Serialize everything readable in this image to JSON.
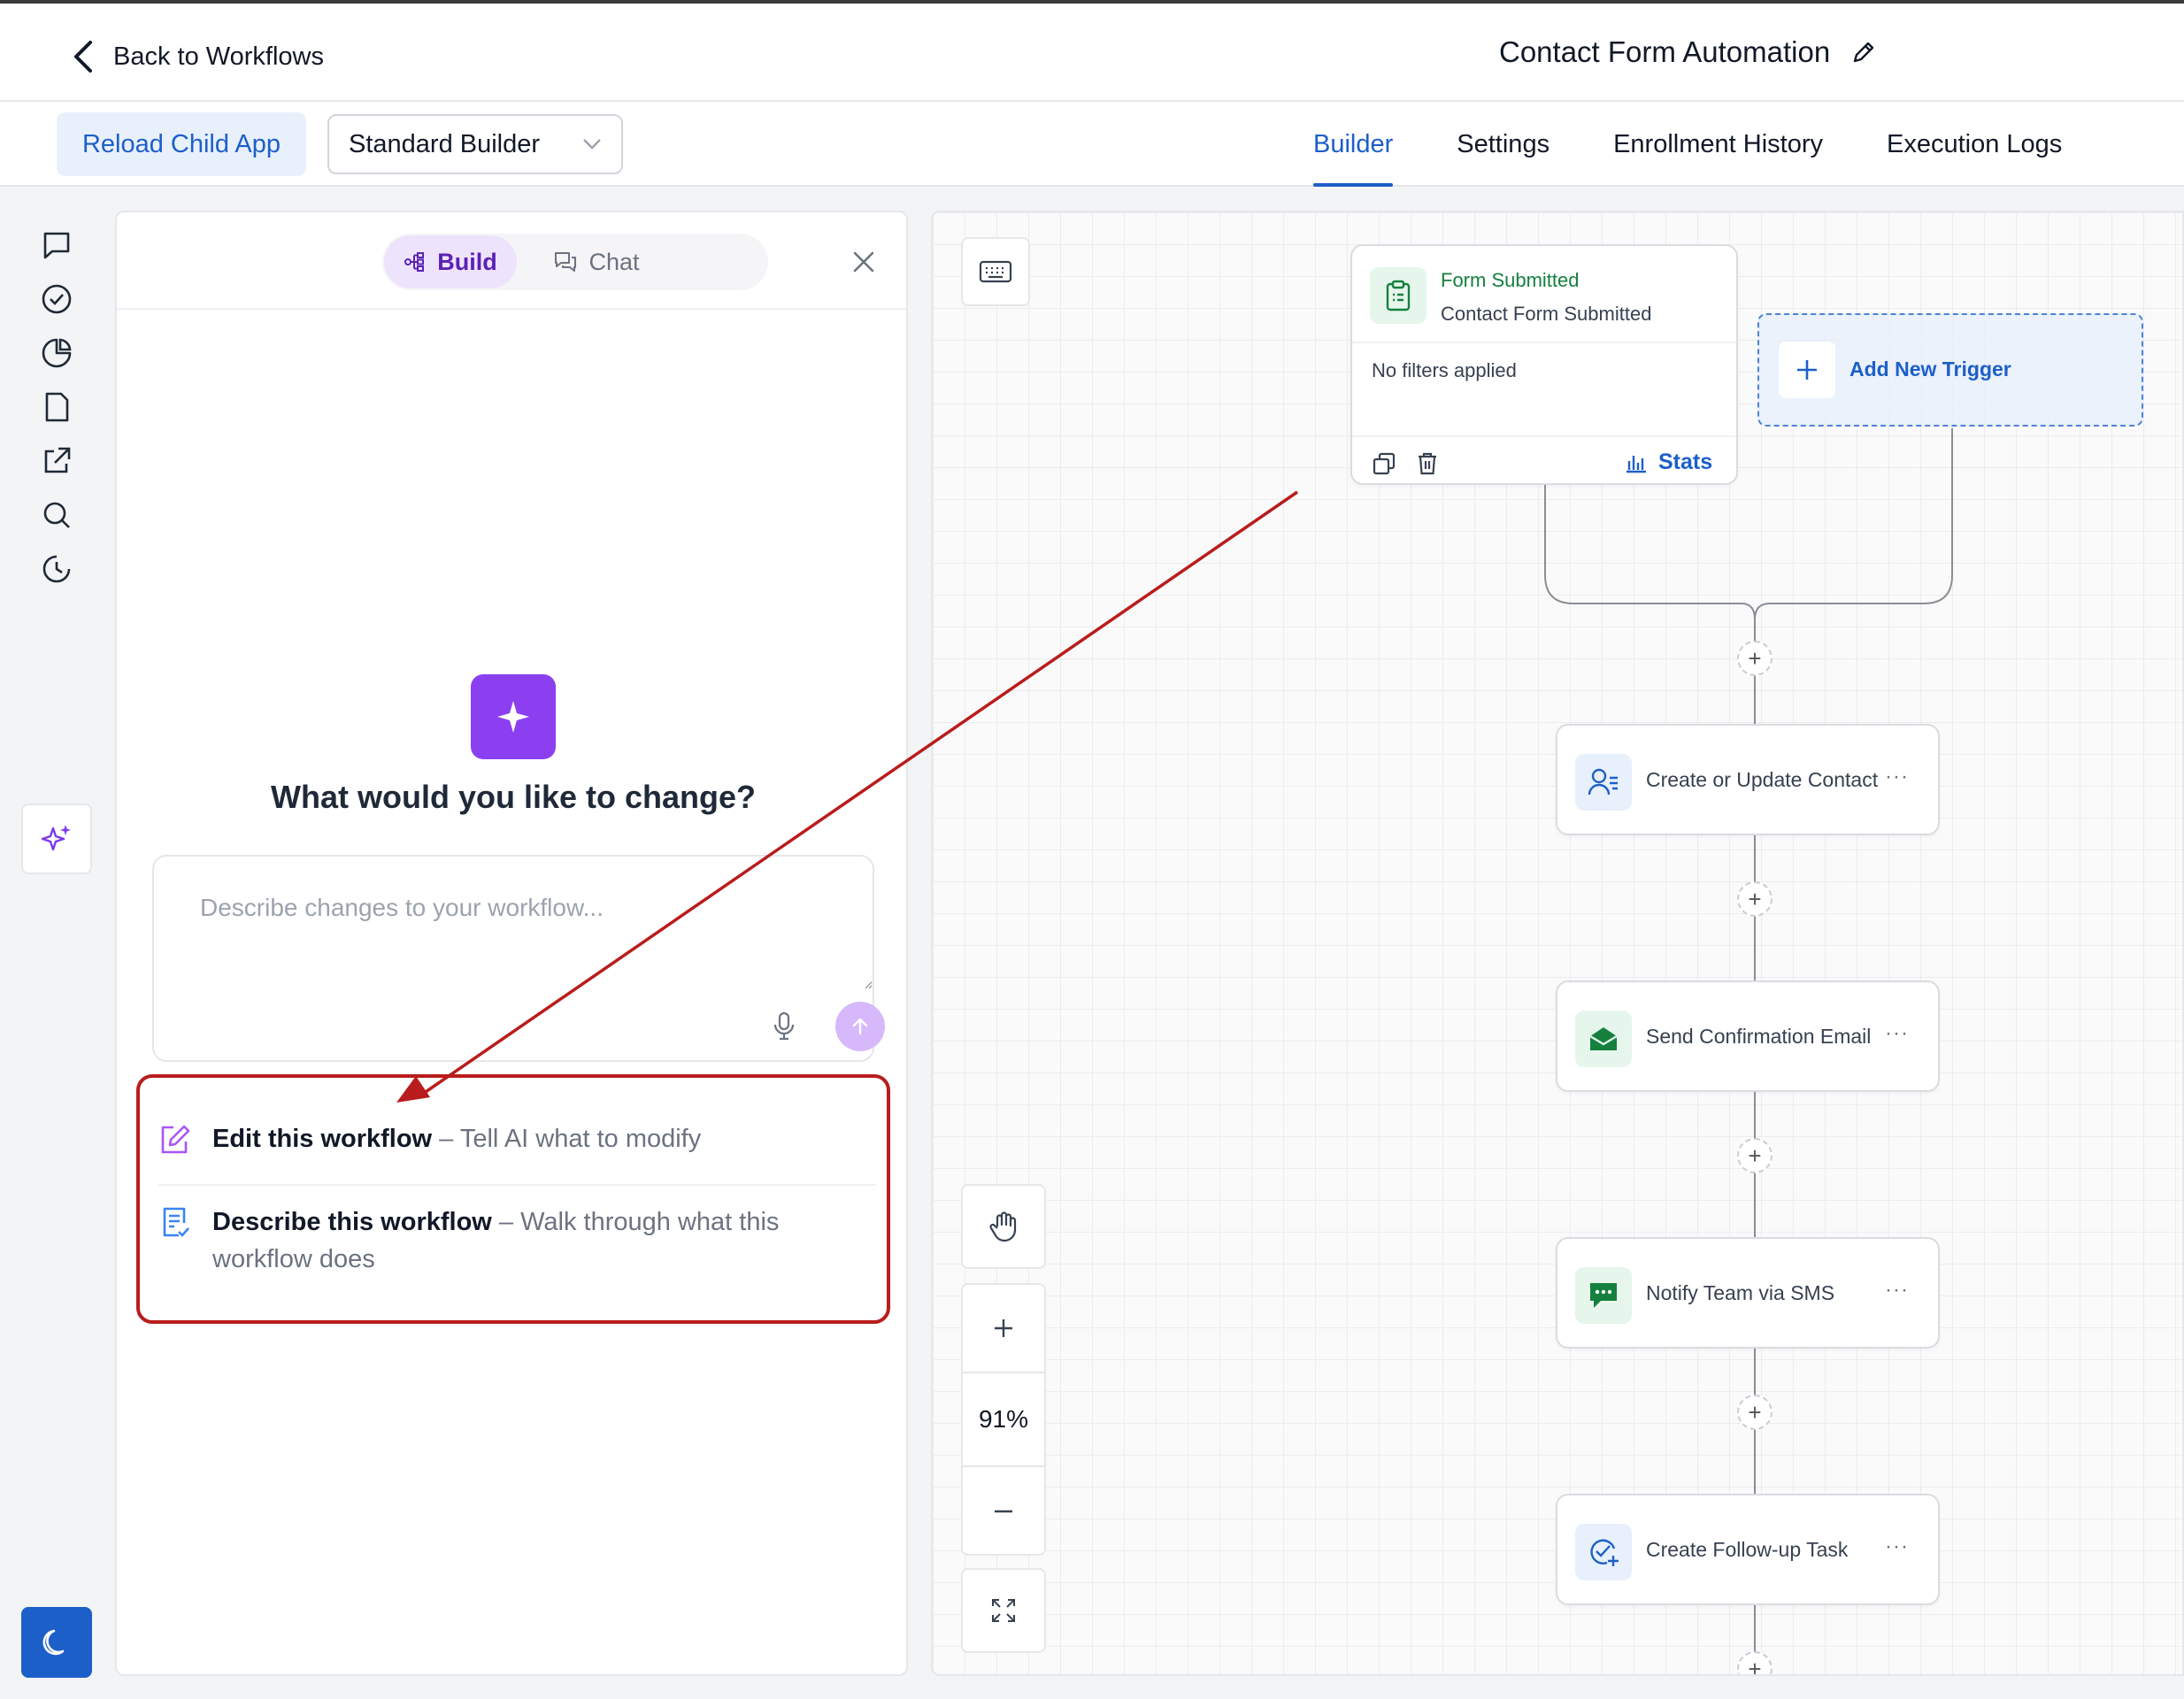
{
  "header": {
    "back_label": "Back to Workflows",
    "title": "Contact Form Automation"
  },
  "toolbar": {
    "reload_label": "Reload Child App",
    "builder_select": "Standard Builder",
    "tabs": [
      "Builder",
      "Settings",
      "Enrollment History",
      "Execution Logs"
    ],
    "active_tab": "Builder"
  },
  "rail": {
    "icons": [
      "chat-icon",
      "check-circle-icon",
      "pie-chart-icon",
      "document-icon",
      "external-link-icon",
      "search-icon",
      "history-icon",
      "sparkles-icon"
    ],
    "bottom_icon": "moon-icon"
  },
  "ai_panel": {
    "tabs": {
      "build": "Build",
      "chat": "Chat"
    },
    "heading": "What would you like to change?",
    "input_placeholder": "Describe changes to your workflow...",
    "suggestions": [
      {
        "title": "Edit this workflow",
        "separator": " – ",
        "description": "Tell AI what to modify"
      },
      {
        "title": "Describe this workflow",
        "separator": " – ",
        "description": "Walk through what this workflow does"
      }
    ]
  },
  "canvas": {
    "zoom": "91%",
    "trigger": {
      "title": "Form Submitted",
      "subtitle": "Contact Form Submitted",
      "filters": "No filters applied",
      "stats_label": "Stats"
    },
    "add_trigger_label": "Add New Trigger",
    "actions": [
      {
        "label": "Create or Update Contact",
        "icon": "contact-icon"
      },
      {
        "label": "Send Confirmation Email",
        "icon": "email-icon"
      },
      {
        "label": "Notify Team via SMS",
        "icon": "sms-icon"
      },
      {
        "label": "Create Follow-up Task",
        "icon": "task-icon"
      }
    ],
    "more_label": "···"
  },
  "colors": {
    "accent": "#1d5fc9",
    "ai_purple": "#8b3ff0",
    "highlight_red": "#b91c1c",
    "green": "#15803d"
  }
}
